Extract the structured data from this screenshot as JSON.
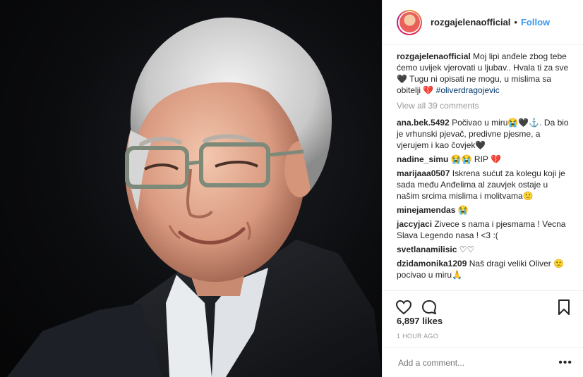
{
  "post": {
    "username": "rozgajelenaofficial",
    "separator": "•",
    "follow_label": "Follow",
    "caption_user": "rozgajelenaofficial",
    "caption_text": "Moj lipi anđele zbog tebe ćemo uvijek vjerovati u ljubav.. Hvala ti za sve 🖤 Tugu ni opisati ne mogu, u mislima sa obitelji 💔",
    "caption_tag": "#oliverdragojevic",
    "view_all": "View all 39 comments",
    "likes": "6,897 likes",
    "time": "1 HOUR AGO",
    "add_comment_placeholder": "Add a comment...",
    "more_label": "•••"
  },
  "comments": [
    {
      "user": "ana.bek.5492",
      "text": "Počivao u miru😭🖤⚓. Da bio je vrhunski pjevač, predivne pjesme, a vjerujem i kao čovjek🖤"
    },
    {
      "user": "nadine_simu",
      "text": "😭😭 RIP 💔"
    },
    {
      "user": "marijaaa0507",
      "text": "Iskrena sućut za kolegu koji je sada među Anđelima al zauvjek ostaje u našim srcima mislima i molitvama🙁"
    },
    {
      "user": "minejamendas",
      "text": "😭"
    },
    {
      "user": "jaccyjaci",
      "text": "Zivece s nama i pjesmama ! Vecna Slava Legendo nasa ! <3 :("
    },
    {
      "user": "svetlanamilisic",
      "text": "♡♡"
    },
    {
      "user": "dzidamonika1209",
      "text": "Naš dragi veliki Oliver 🙁 pocivao u miru🙏"
    }
  ],
  "colors": {
    "accent": "#3897f0",
    "hashtag": "#003569",
    "muted": "#999999",
    "text": "#262626"
  },
  "icons": [
    "heart-icon",
    "comment-icon",
    "bookmark-icon",
    "more-icon"
  ]
}
